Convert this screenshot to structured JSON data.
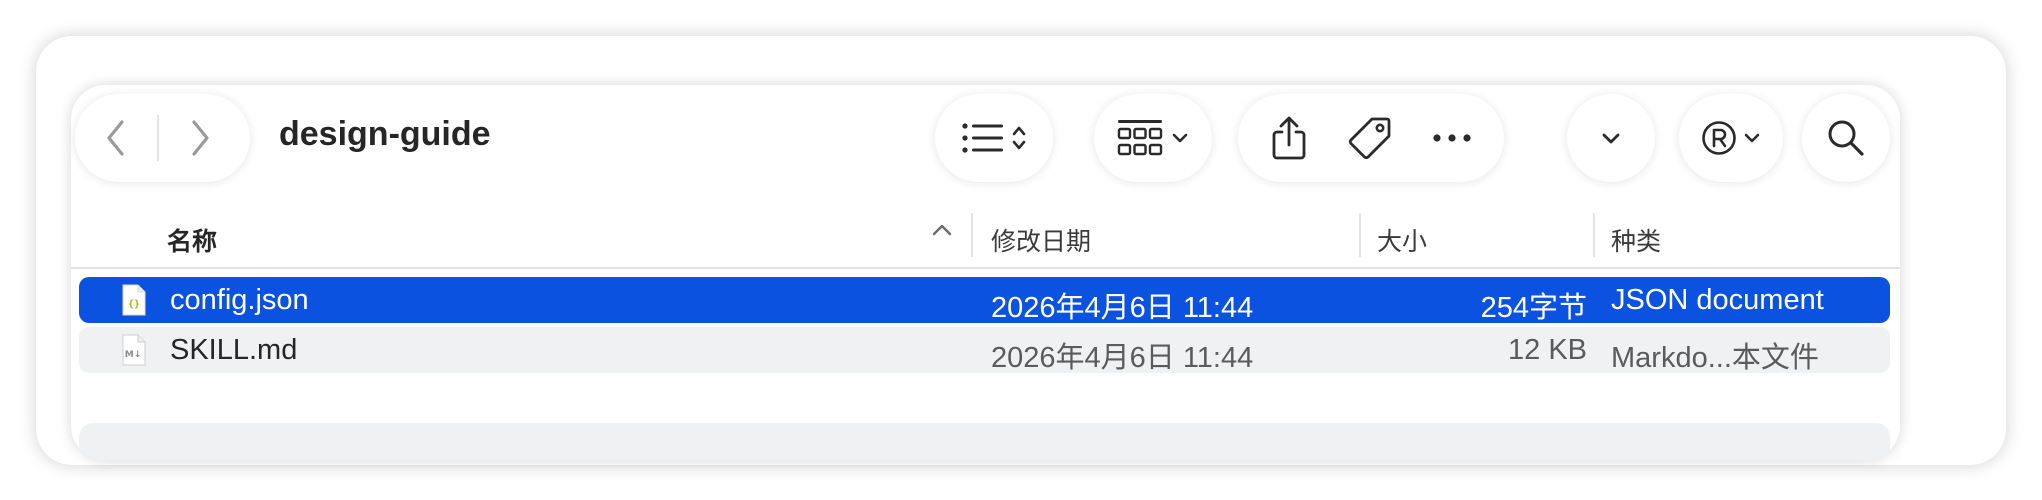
{
  "window": {
    "title": "design-guide"
  },
  "toolbar": {
    "back_icon": "chevron-left-icon",
    "forward_icon": "chevron-right-icon",
    "view_icon": "list-view-icon",
    "group_icon": "grid-group-icon",
    "share_icon": "share-icon",
    "tag_icon": "tag-icon",
    "more_icon": "ellipsis-icon",
    "dropdown_icon": "chevron-down-icon",
    "registered_icon": "registered-icon",
    "search_icon": "search-icon"
  },
  "columns": {
    "name": "名称",
    "modified": "修改日期",
    "size": "大小",
    "kind": "种类"
  },
  "files": [
    {
      "name": "config.json",
      "modified": "2026年4月6日 11:44",
      "size": "254字节",
      "kind": "JSON document",
      "icon": "json-file-icon",
      "selected": true
    },
    {
      "name": "SKILL.md",
      "modified": "2026年4月6日 11:44",
      "size": "12 KB",
      "kind": "Markdo...本文件",
      "icon": "markdown-file-icon",
      "selected": false
    }
  ],
  "colors": {
    "selection": "#0b52e0",
    "alt_row": "#f0f1f3",
    "json_icon_accent": "#b3b000"
  }
}
